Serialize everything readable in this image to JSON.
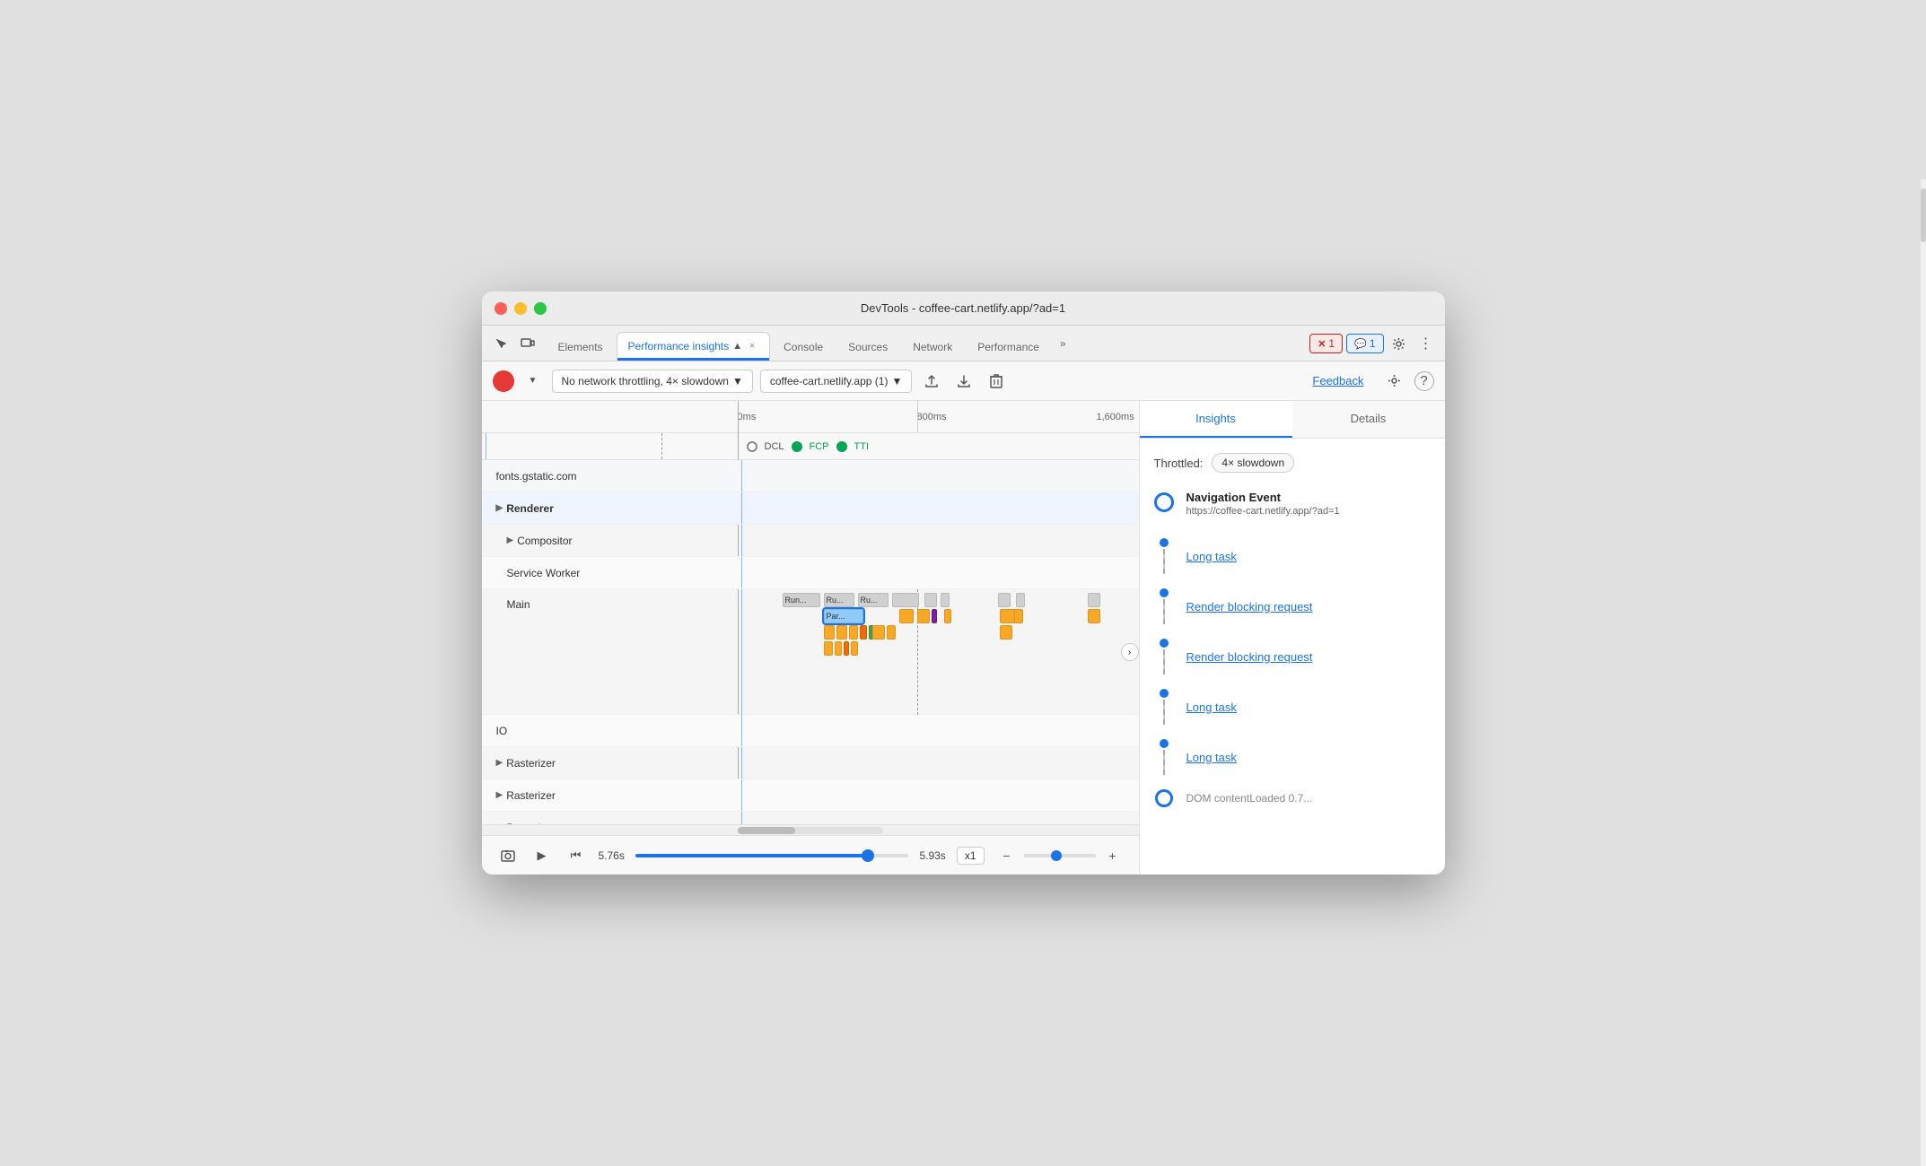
{
  "window": {
    "title": "DevTools - coffee-cart.netlify.app/?ad=1"
  },
  "tabs": [
    {
      "id": "elements",
      "label": "Elements",
      "active": false
    },
    {
      "id": "performance-insights",
      "label": "Performance insights",
      "active": true,
      "closable": true
    },
    {
      "id": "console",
      "label": "Console",
      "active": false
    },
    {
      "id": "sources",
      "label": "Sources",
      "active": false
    },
    {
      "id": "network",
      "label": "Network",
      "active": false
    },
    {
      "id": "performance",
      "label": "Performance",
      "active": false
    }
  ],
  "toolbar": {
    "throttling_label": "No network throttling, 4× slowdown",
    "target_label": "coffee-cart.netlify.app (1)",
    "feedback_label": "Feedback",
    "record_label": "Record"
  },
  "timeline": {
    "times": [
      "0ms",
      "800ms",
      "1,600ms"
    ],
    "markers": [
      "DCL",
      "FCP",
      "TTI"
    ],
    "rows": [
      {
        "id": "fonts",
        "label": "fonts.gstatic.com",
        "indent": 0,
        "bold": false
      },
      {
        "id": "renderer",
        "label": "Renderer",
        "indent": 0,
        "bold": true
      },
      {
        "id": "compositor",
        "label": "Compositor",
        "indent": 1,
        "bold": false
      },
      {
        "id": "service-worker",
        "label": "Service Worker",
        "indent": 1,
        "bold": false
      },
      {
        "id": "main",
        "label": "Main",
        "indent": 1,
        "bold": false
      },
      {
        "id": "io",
        "label": "IO",
        "indent": 0,
        "bold": false
      },
      {
        "id": "rasterizer1",
        "label": "Rasterizer",
        "indent": 0,
        "bold": false
      },
      {
        "id": "rasterizer2",
        "label": "Rasterizer",
        "indent": 0,
        "bold": false
      },
      {
        "id": "rasterizer3",
        "label": "Rasterizer...",
        "indent": 0,
        "bold": false
      }
    ],
    "start_time": "5.76s",
    "end_time": "5.93s",
    "speed": "x1"
  },
  "insights": {
    "tabs": [
      "Insights",
      "Details"
    ],
    "active_tab": "Insights",
    "throttled": "4× slowdown",
    "navigation_event": {
      "title": "Navigation Event",
      "url": "https://coffee-cart.netlify.app/?ad=1"
    },
    "items": [
      {
        "id": "long-task-1",
        "label": "Long task",
        "type": "link"
      },
      {
        "id": "render-blocking-1",
        "label": "Render blocking request",
        "type": "link"
      },
      {
        "id": "render-blocking-2",
        "label": "Render blocking request",
        "type": "link"
      },
      {
        "id": "long-task-2",
        "label": "Long task",
        "type": "link"
      },
      {
        "id": "long-task-3",
        "label": "Long task",
        "type": "link"
      },
      {
        "id": "dom-content",
        "label": "DOM contentLoaded 0.7...",
        "type": "partial"
      }
    ]
  },
  "bottom_bar": {
    "start_time": "5.76s",
    "end_time": "5.93s",
    "speed": "x1"
  },
  "colors": {
    "accent": "#1a73e8",
    "record": "#e53935",
    "fcp_green": "#00a651",
    "block_yellow": "#f9a825",
    "block_gray": "#d0d0d0"
  }
}
